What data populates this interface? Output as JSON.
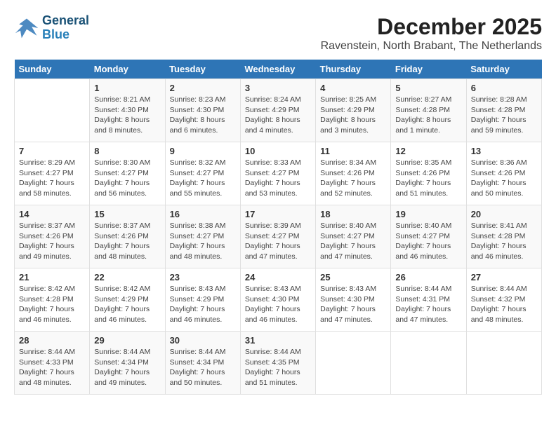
{
  "logo": {
    "line1": "General",
    "line2": "Blue"
  },
  "title": "December 2025",
  "location": "Ravenstein, North Brabant, The Netherlands",
  "headers": [
    "Sunday",
    "Monday",
    "Tuesday",
    "Wednesday",
    "Thursday",
    "Friday",
    "Saturday"
  ],
  "weeks": [
    [
      {
        "day": "",
        "info": ""
      },
      {
        "day": "1",
        "info": "Sunrise: 8:21 AM\nSunset: 4:30 PM\nDaylight: 8 hours\nand 8 minutes."
      },
      {
        "day": "2",
        "info": "Sunrise: 8:23 AM\nSunset: 4:30 PM\nDaylight: 8 hours\nand 6 minutes."
      },
      {
        "day": "3",
        "info": "Sunrise: 8:24 AM\nSunset: 4:29 PM\nDaylight: 8 hours\nand 4 minutes."
      },
      {
        "day": "4",
        "info": "Sunrise: 8:25 AM\nSunset: 4:29 PM\nDaylight: 8 hours\nand 3 minutes."
      },
      {
        "day": "5",
        "info": "Sunrise: 8:27 AM\nSunset: 4:28 PM\nDaylight: 8 hours\nand 1 minute."
      },
      {
        "day": "6",
        "info": "Sunrise: 8:28 AM\nSunset: 4:28 PM\nDaylight: 7 hours\nand 59 minutes."
      }
    ],
    [
      {
        "day": "7",
        "info": "Sunrise: 8:29 AM\nSunset: 4:27 PM\nDaylight: 7 hours\nand 58 minutes."
      },
      {
        "day": "8",
        "info": "Sunrise: 8:30 AM\nSunset: 4:27 PM\nDaylight: 7 hours\nand 56 minutes."
      },
      {
        "day": "9",
        "info": "Sunrise: 8:32 AM\nSunset: 4:27 PM\nDaylight: 7 hours\nand 55 minutes."
      },
      {
        "day": "10",
        "info": "Sunrise: 8:33 AM\nSunset: 4:27 PM\nDaylight: 7 hours\nand 53 minutes."
      },
      {
        "day": "11",
        "info": "Sunrise: 8:34 AM\nSunset: 4:26 PM\nDaylight: 7 hours\nand 52 minutes."
      },
      {
        "day": "12",
        "info": "Sunrise: 8:35 AM\nSunset: 4:26 PM\nDaylight: 7 hours\nand 51 minutes."
      },
      {
        "day": "13",
        "info": "Sunrise: 8:36 AM\nSunset: 4:26 PM\nDaylight: 7 hours\nand 50 minutes."
      }
    ],
    [
      {
        "day": "14",
        "info": "Sunrise: 8:37 AM\nSunset: 4:26 PM\nDaylight: 7 hours\nand 49 minutes."
      },
      {
        "day": "15",
        "info": "Sunrise: 8:37 AM\nSunset: 4:26 PM\nDaylight: 7 hours\nand 48 minutes."
      },
      {
        "day": "16",
        "info": "Sunrise: 8:38 AM\nSunset: 4:27 PM\nDaylight: 7 hours\nand 48 minutes."
      },
      {
        "day": "17",
        "info": "Sunrise: 8:39 AM\nSunset: 4:27 PM\nDaylight: 7 hours\nand 47 minutes."
      },
      {
        "day": "18",
        "info": "Sunrise: 8:40 AM\nSunset: 4:27 PM\nDaylight: 7 hours\nand 47 minutes."
      },
      {
        "day": "19",
        "info": "Sunrise: 8:40 AM\nSunset: 4:27 PM\nDaylight: 7 hours\nand 46 minutes."
      },
      {
        "day": "20",
        "info": "Sunrise: 8:41 AM\nSunset: 4:28 PM\nDaylight: 7 hours\nand 46 minutes."
      }
    ],
    [
      {
        "day": "21",
        "info": "Sunrise: 8:42 AM\nSunset: 4:28 PM\nDaylight: 7 hours\nand 46 minutes."
      },
      {
        "day": "22",
        "info": "Sunrise: 8:42 AM\nSunset: 4:29 PM\nDaylight: 7 hours\nand 46 minutes."
      },
      {
        "day": "23",
        "info": "Sunrise: 8:43 AM\nSunset: 4:29 PM\nDaylight: 7 hours\nand 46 minutes."
      },
      {
        "day": "24",
        "info": "Sunrise: 8:43 AM\nSunset: 4:30 PM\nDaylight: 7 hours\nand 46 minutes."
      },
      {
        "day": "25",
        "info": "Sunrise: 8:43 AM\nSunset: 4:30 PM\nDaylight: 7 hours\nand 47 minutes."
      },
      {
        "day": "26",
        "info": "Sunrise: 8:44 AM\nSunset: 4:31 PM\nDaylight: 7 hours\nand 47 minutes."
      },
      {
        "day": "27",
        "info": "Sunrise: 8:44 AM\nSunset: 4:32 PM\nDaylight: 7 hours\nand 48 minutes."
      }
    ],
    [
      {
        "day": "28",
        "info": "Sunrise: 8:44 AM\nSunset: 4:33 PM\nDaylight: 7 hours\nand 48 minutes."
      },
      {
        "day": "29",
        "info": "Sunrise: 8:44 AM\nSunset: 4:34 PM\nDaylight: 7 hours\nand 49 minutes."
      },
      {
        "day": "30",
        "info": "Sunrise: 8:44 AM\nSunset: 4:34 PM\nDaylight: 7 hours\nand 50 minutes."
      },
      {
        "day": "31",
        "info": "Sunrise: 8:44 AM\nSunset: 4:35 PM\nDaylight: 7 hours\nand 51 minutes."
      },
      {
        "day": "",
        "info": ""
      },
      {
        "day": "",
        "info": ""
      },
      {
        "day": "",
        "info": ""
      }
    ]
  ]
}
